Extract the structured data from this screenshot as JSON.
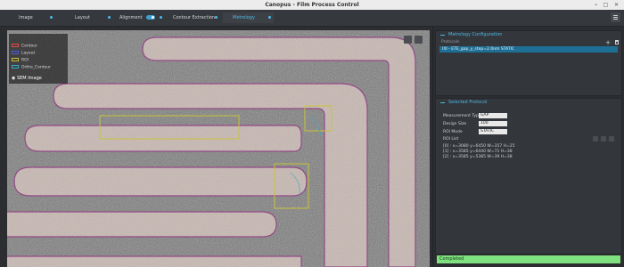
{
  "window": {
    "title": "Canopus - Film Process Control"
  },
  "tabs": [
    {
      "label": "Image"
    },
    {
      "label": "Layout"
    },
    {
      "label": "Alignment"
    },
    {
      "label": "Contour Extraction"
    },
    {
      "label": "Metrology"
    }
  ],
  "legend": {
    "items": [
      {
        "label": "Contour",
        "color": "#e24a4a"
      },
      {
        "label": "Layout",
        "color": "#4a5bd8"
      },
      {
        "label": "ROI",
        "color": "#c8c23a"
      },
      {
        "label": "Ortho_Contour",
        "color": "#3ca9c8"
      }
    ],
    "caption": "SEM Image"
  },
  "metrology_config": {
    "title": "Metrology Configuration",
    "list_header": "Protocols",
    "protocols": [
      "IXI - ETE_gap_y_step=2.0nm STATIC"
    ]
  },
  "selected_protocol": {
    "title": "Selected Protocol",
    "fields": [
      {
        "label": "Measurement Type",
        "value": "GAP"
      },
      {
        "label": "Design Size",
        "value": "100"
      },
      {
        "label": "ROI Mode",
        "value": "STATIC"
      }
    ],
    "roi_list_label": "ROI List",
    "roi_list": [
      "[0] : x=3080 y=6450 W=357 H=25",
      "[1] : x=3585 y=6440 W=71 H=38",
      "[2] : x=3585 y=5385 W=39 H=38"
    ]
  },
  "status": {
    "text": "Completed",
    "color": "#7ee07e"
  }
}
